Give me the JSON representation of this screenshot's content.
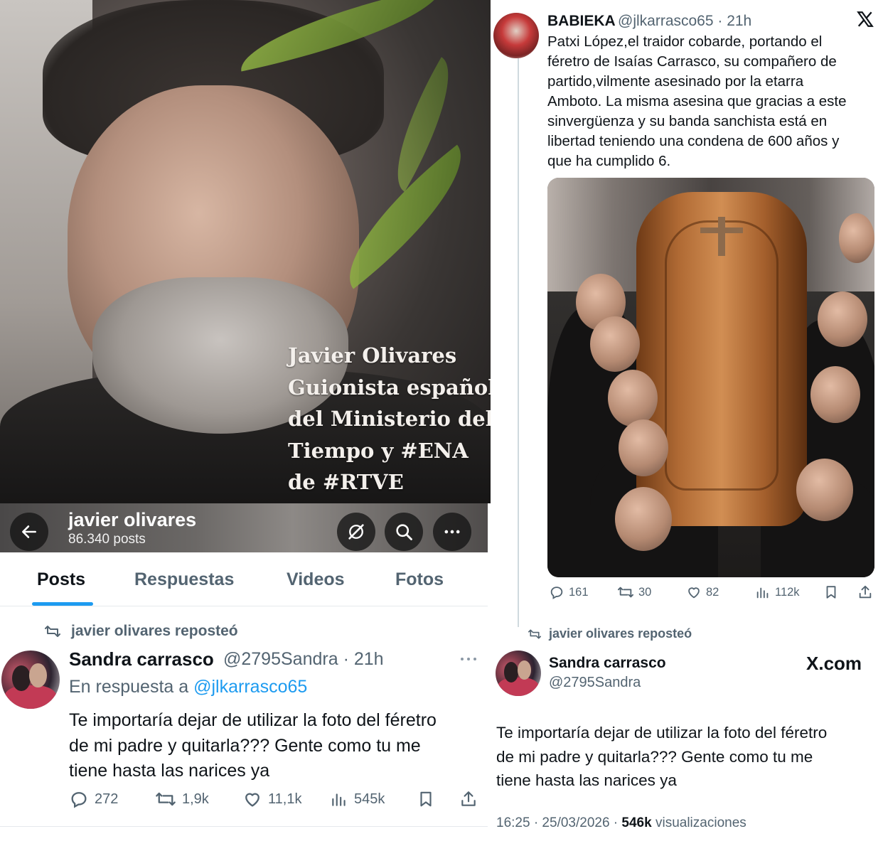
{
  "left": {
    "header_caption": [
      "Javier Olivares",
      "Guionista español",
      "del Ministerio del",
      "Tiempo y #ENA",
      "de #RTVE"
    ],
    "profile": {
      "name": "javier olivares",
      "posts_count": "86.340 posts"
    },
    "tabs": [
      {
        "label": "Posts",
        "active": true
      },
      {
        "label": "Respuestas",
        "active": false
      },
      {
        "label": "Videos",
        "active": false
      },
      {
        "label": "Fotos",
        "active": false
      }
    ],
    "repost_label": "javier olivares reposteó",
    "tweet": {
      "name": "Sandra carrasco",
      "handle": "@2795Sandra",
      "dot": "·",
      "time": "21h",
      "reply_prefix": "En respuesta a",
      "reply_handle": "@jlkarrasco65",
      "text_lines": [
        "Te importaría dejar de utilizar la foto del féretro",
        "de mi padre y quitarla??? Gente como tu me",
        "tiene hasta las narices ya"
      ],
      "actions": {
        "replies": "272",
        "reposts": "1,9k",
        "likes": "11,1k",
        "views": "545k"
      }
    }
  },
  "right": {
    "original": {
      "name": "BABIEKA",
      "handle_time": "@jlkarrasco65 · 21h",
      "text_lines": [
        "Patxi López,el traidor cobarde, portando el",
        "féretro de Isaías Carrasco, su compañero de",
        "partido,vilmente asesinado por la etarra",
        "Amboto. La misma asesina que gracias a este",
        "sinvergüenza y su banda sanchista está en",
        "libertad teniendo una condena de 600 años y",
        "que ha cumplido 6."
      ],
      "actions": {
        "replies": "161",
        "reposts": "30",
        "likes": "82",
        "views": "112k"
      }
    },
    "repost_label": "javier olivares reposteó",
    "reply": {
      "name": "Sandra carrasco",
      "handle": "@2795Sandra",
      "brand": "X.com",
      "text_lines": [
        "Te importaría dejar de utilizar la foto del féretro",
        "de mi padre y quitarla??? Gente como tu me",
        "tiene hasta las narices ya"
      ],
      "timestamp": "16:25 · 25/03/2026 ·",
      "views_count": "546k",
      "views_label": "visualizaciones"
    }
  },
  "colors": {
    "accent": "#1d9bf0",
    "text": "#0f1419",
    "muted": "#536471",
    "border": "#e6e9ec"
  }
}
